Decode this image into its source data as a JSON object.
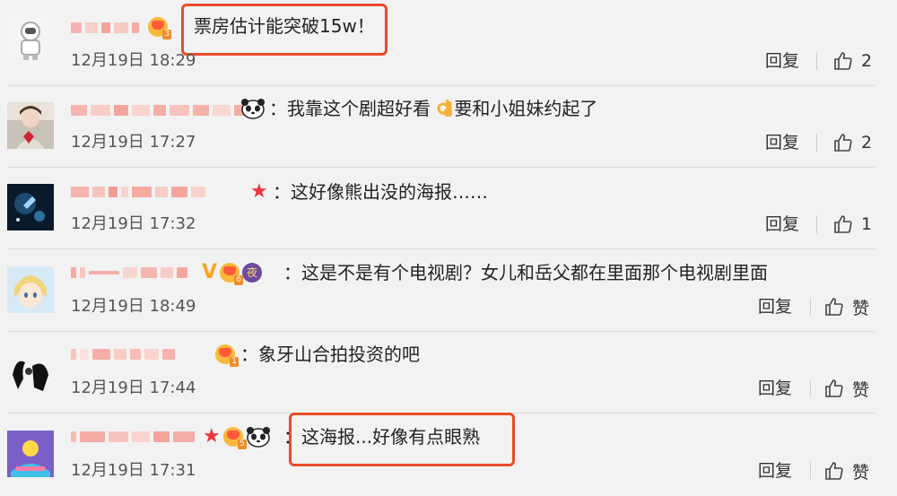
{
  "comments": [
    {
      "text": "票房估计能突破15w！",
      "time": "12月19日 18:29",
      "reply_label": "回复",
      "like_count": "2",
      "highlighted": true
    },
    {
      "text": "我靠这个剧超好看",
      "text_after_emoji": "要和小姐妹约起了",
      "time": "12月19日 17:27",
      "reply_label": "回复",
      "like_count": "2",
      "highlighted": false
    },
    {
      "text": "这好像熊出没的海报……",
      "time": "12月19日 17:32",
      "reply_label": "回复",
      "like_count": "1",
      "highlighted": false
    },
    {
      "text": "这是不是有个电视剧？女儿和岳父都在里面那个电视剧里面",
      "time": "12月19日 18:49",
      "reply_label": "回复",
      "like_count": "赞",
      "highlighted": false
    },
    {
      "text": "象牙山合拍投资的吧",
      "time": "12月19日 17:44",
      "reply_label": "回复",
      "like_count": "赞",
      "highlighted": false
    },
    {
      "text": "这海报...好像有点眼熟",
      "time": "12月19日 17:31",
      "reply_label": "回复",
      "like_count": "赞",
      "highlighted": true
    }
  ],
  "colors": {
    "highlight_border": "#ea4b2a",
    "star": "#e8363a",
    "background": "#f2f2f2"
  },
  "icons": [
    "thumbs-up-icon",
    "crown-badge-icon",
    "panda-emoji-icon",
    "star-icon",
    "v-badge-icon",
    "night-badge-icon",
    "ok-hand-emoji-icon"
  ]
}
